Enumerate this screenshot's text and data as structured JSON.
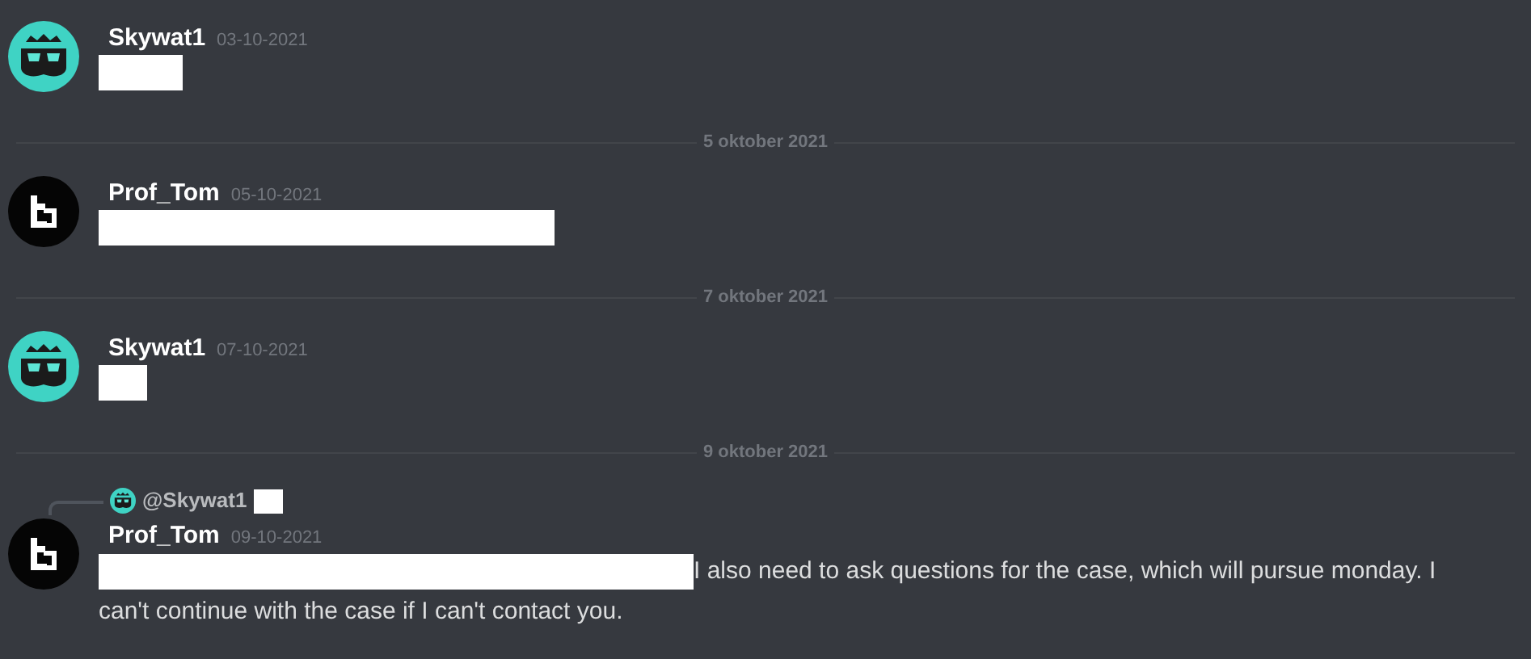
{
  "messages": [
    {
      "kind": "message",
      "author": "Skywat1",
      "avatar": {
        "kind": "mask"
      },
      "timestamp": "03-10-2021",
      "redacted": true
    },
    {
      "kind": "divider",
      "label": "5 oktober 2021"
    },
    {
      "kind": "message",
      "author": "Prof_Tom",
      "avatar": {
        "kind": "logo"
      },
      "timestamp": "05-10-2021",
      "redacted": true
    },
    {
      "kind": "divider",
      "label": "7 oktober 2021"
    },
    {
      "kind": "message",
      "author": "Skywat1",
      "avatar": {
        "kind": "mask"
      },
      "timestamp": "07-10-2021",
      "redacted": true
    },
    {
      "kind": "divider",
      "label": "9 oktober 2021"
    },
    {
      "kind": "message",
      "author": "Prof_Tom",
      "avatar": {
        "kind": "logo"
      },
      "timestamp": "09-10-2021",
      "redacted": true,
      "reply": {
        "mention": "@Skywat1",
        "avatar": {
          "kind": "mask"
        },
        "redacted": true
      },
      "text_lines": [
        "I also need to ask questions for the case, which will pursue monday. I",
        "can't continue with the case if I can't contact you."
      ]
    }
  ]
}
